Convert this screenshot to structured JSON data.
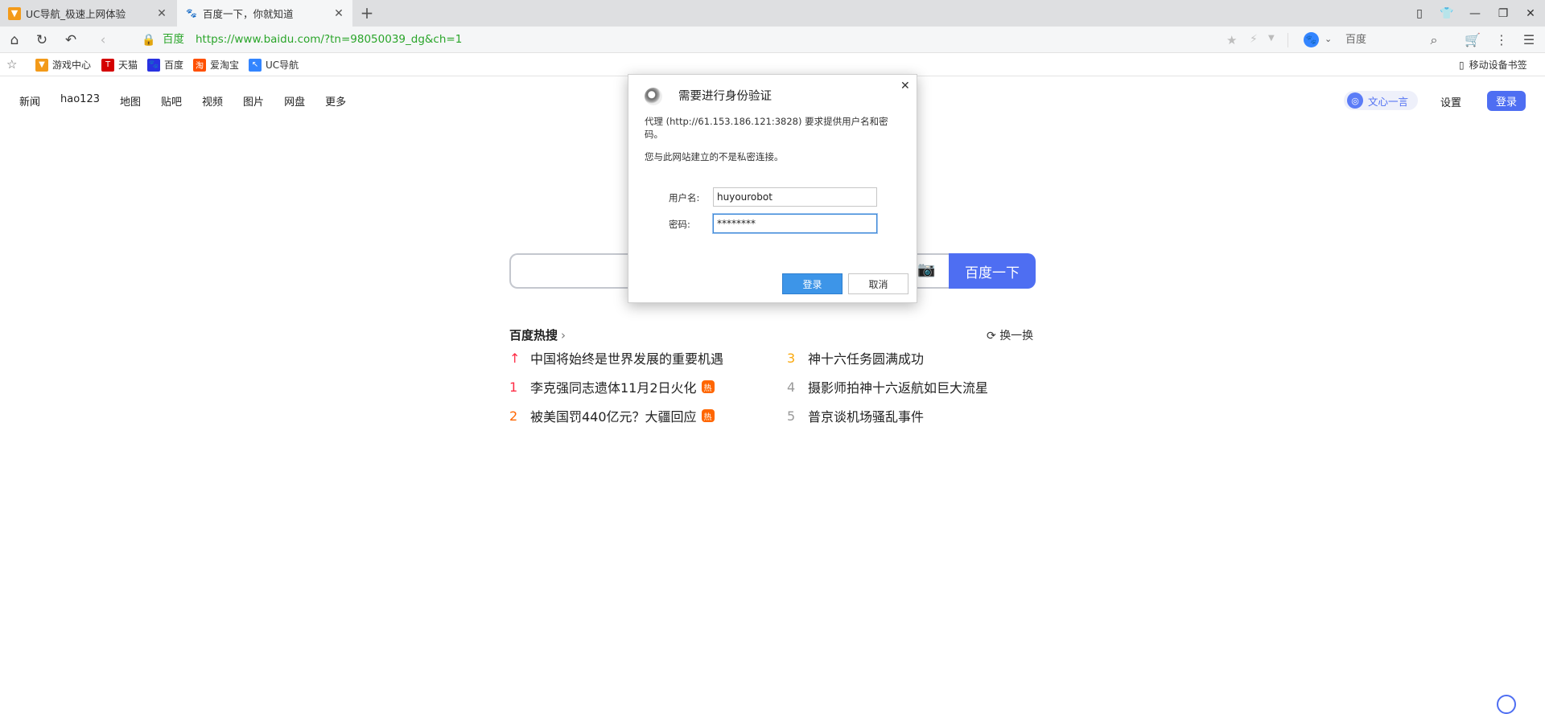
{
  "browser": {
    "tabs": [
      {
        "title": "UC导航_极速上网体验",
        "favicon": "uc-icon"
      },
      {
        "title": "百度一下，你就知道",
        "favicon": "baidu-paw-icon"
      }
    ],
    "address": {
      "site_name": "百度",
      "url": "https://www.baidu.com/?tn=98050039_dg&ch=1"
    },
    "search_engine": {
      "name": "百度"
    },
    "bookmarks": [
      {
        "label": "游戏中心",
        "color": "#f39a19"
      },
      {
        "label": "天猫",
        "color": "#d40000"
      },
      {
        "label": "百度",
        "color": "#2932e1"
      },
      {
        "label": "爱淘宝",
        "color": "#ff5000"
      },
      {
        "label": "UC导航",
        "color": "#3385ff"
      }
    ],
    "mobile_bookmarks": "移动设备书签"
  },
  "page": {
    "nav": [
      "新闻",
      "hao123",
      "地图",
      "贴吧",
      "视频",
      "图片",
      "网盘",
      "更多"
    ],
    "wenxin": "文心一言",
    "settings": "设置",
    "login": "登录",
    "search_button": "百度一下",
    "hot": {
      "title": "百度热搜",
      "refresh": "换一换",
      "items": [
        {
          "rank": "↑",
          "text": "中国将始终是世界发展的重要机遇",
          "badge": ""
        },
        {
          "rank": "1",
          "text": "李克强同志遗体11月2日火化",
          "badge": "热"
        },
        {
          "rank": "2",
          "text": "被美国罚440亿元？大疆回应",
          "badge": "热"
        },
        {
          "rank": "3",
          "text": "神十六任务圆满成功",
          "badge": ""
        },
        {
          "rank": "4",
          "text": "摄影师拍神十六返航如巨大流星",
          "badge": ""
        },
        {
          "rank": "5",
          "text": "普京谈机场骚乱事件",
          "badge": ""
        }
      ]
    }
  },
  "dialog": {
    "title": "需要进行身份验证",
    "message": "代理 (http://61.153.186.121:3828) 要求提供用户名和密码。",
    "note": "您与此网站建立的不是私密连接。",
    "username_label": "用户名:",
    "username_value": "huyourobot",
    "password_label": "密码:",
    "password_value": "********",
    "ok": "登录",
    "cancel": "取消"
  }
}
